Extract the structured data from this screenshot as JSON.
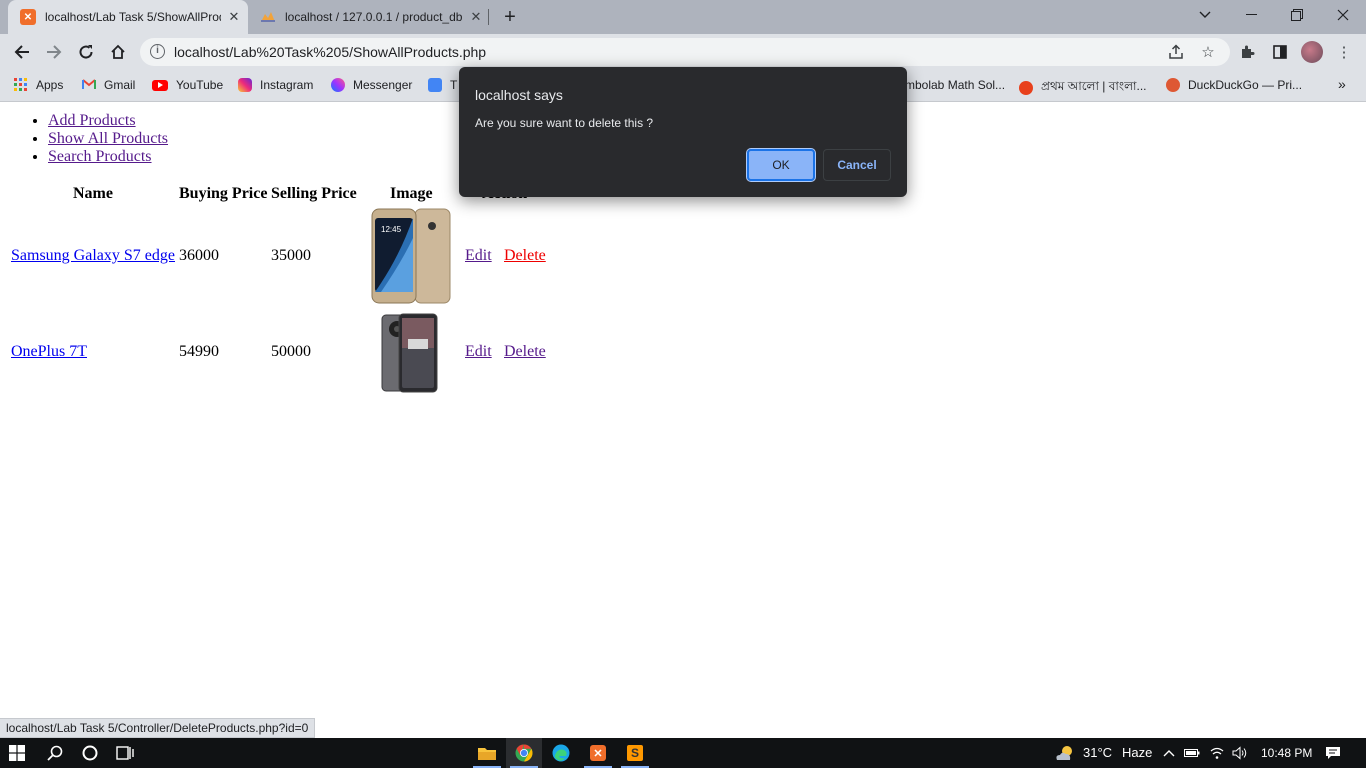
{
  "browser": {
    "tabs": [
      {
        "title": "localhost/Lab Task 5/ShowAllProd",
        "active": true,
        "favicon": "xampp-icon",
        "favicon_color": "#f06e2b"
      },
      {
        "title": "localhost / 127.0.0.1 / product_db",
        "active": false,
        "favicon": "phpmyadmin-icon",
        "favicon_color": "#f2a33a"
      }
    ],
    "url": "localhost/Lab%20Task%205/ShowAllProducts.php",
    "bookmarks": [
      {
        "label": "Apps",
        "icon": "apps-grid-icon",
        "color": "#ea4335"
      },
      {
        "label": "Gmail",
        "icon": "gmail-icon",
        "color": "#ea4335"
      },
      {
        "label": "YouTube",
        "icon": "youtube-icon",
        "color": "#ff0000"
      },
      {
        "label": "Instagram",
        "icon": "instagram-icon",
        "color": "#d6249f"
      },
      {
        "label": "Messenger",
        "icon": "messenger-icon",
        "color": "#0a7cff"
      },
      {
        "label": "T",
        "icon": "translate-icon",
        "color": "#4285f4"
      },
      {
        "label": "mbolab Math Sol...",
        "icon": "symbolab-icon",
        "color": "#dd4b39"
      },
      {
        "label": "প্রথম আলো | বাংলা...",
        "icon": "prothomalo-icon",
        "color": "#e8401c"
      },
      {
        "label": "DuckDuckGo — Pri...",
        "icon": "duckduckgo-icon",
        "color": "#de5833"
      }
    ]
  },
  "page": {
    "menu": [
      "Add Products",
      "Show All Products",
      "Search Products"
    ],
    "table": {
      "headers": [
        "Name",
        "Buying Price",
        "Selling Price",
        "Image",
        "Action"
      ],
      "rows": [
        {
          "name": "Samsung Galaxy S7 edge",
          "buying": "36000",
          "selling": "35000",
          "image": "samsung-galaxy-s7-edge-image",
          "edit": "Edit",
          "delete": "Delete"
        },
        {
          "name": "OnePlus 7T",
          "buying": "54990",
          "selling": "50000",
          "image": "oneplus-7t-image",
          "edit": "Edit",
          "delete": "Delete"
        }
      ]
    }
  },
  "dialog": {
    "title": "localhost says",
    "message": "Are you sure want to delete this ?",
    "ok": "OK",
    "cancel": "Cancel"
  },
  "status_url": "localhost/Lab Task 5/Controller/DeleteProducts.php?id=0",
  "taskbar": {
    "temperature": "31°C",
    "weather": "Haze",
    "time": "10:48 PM",
    "apps": [
      "file-explorer-icon",
      "chrome-icon",
      "edge-icon",
      "xampp-icon",
      "sublime-text-icon"
    ]
  }
}
